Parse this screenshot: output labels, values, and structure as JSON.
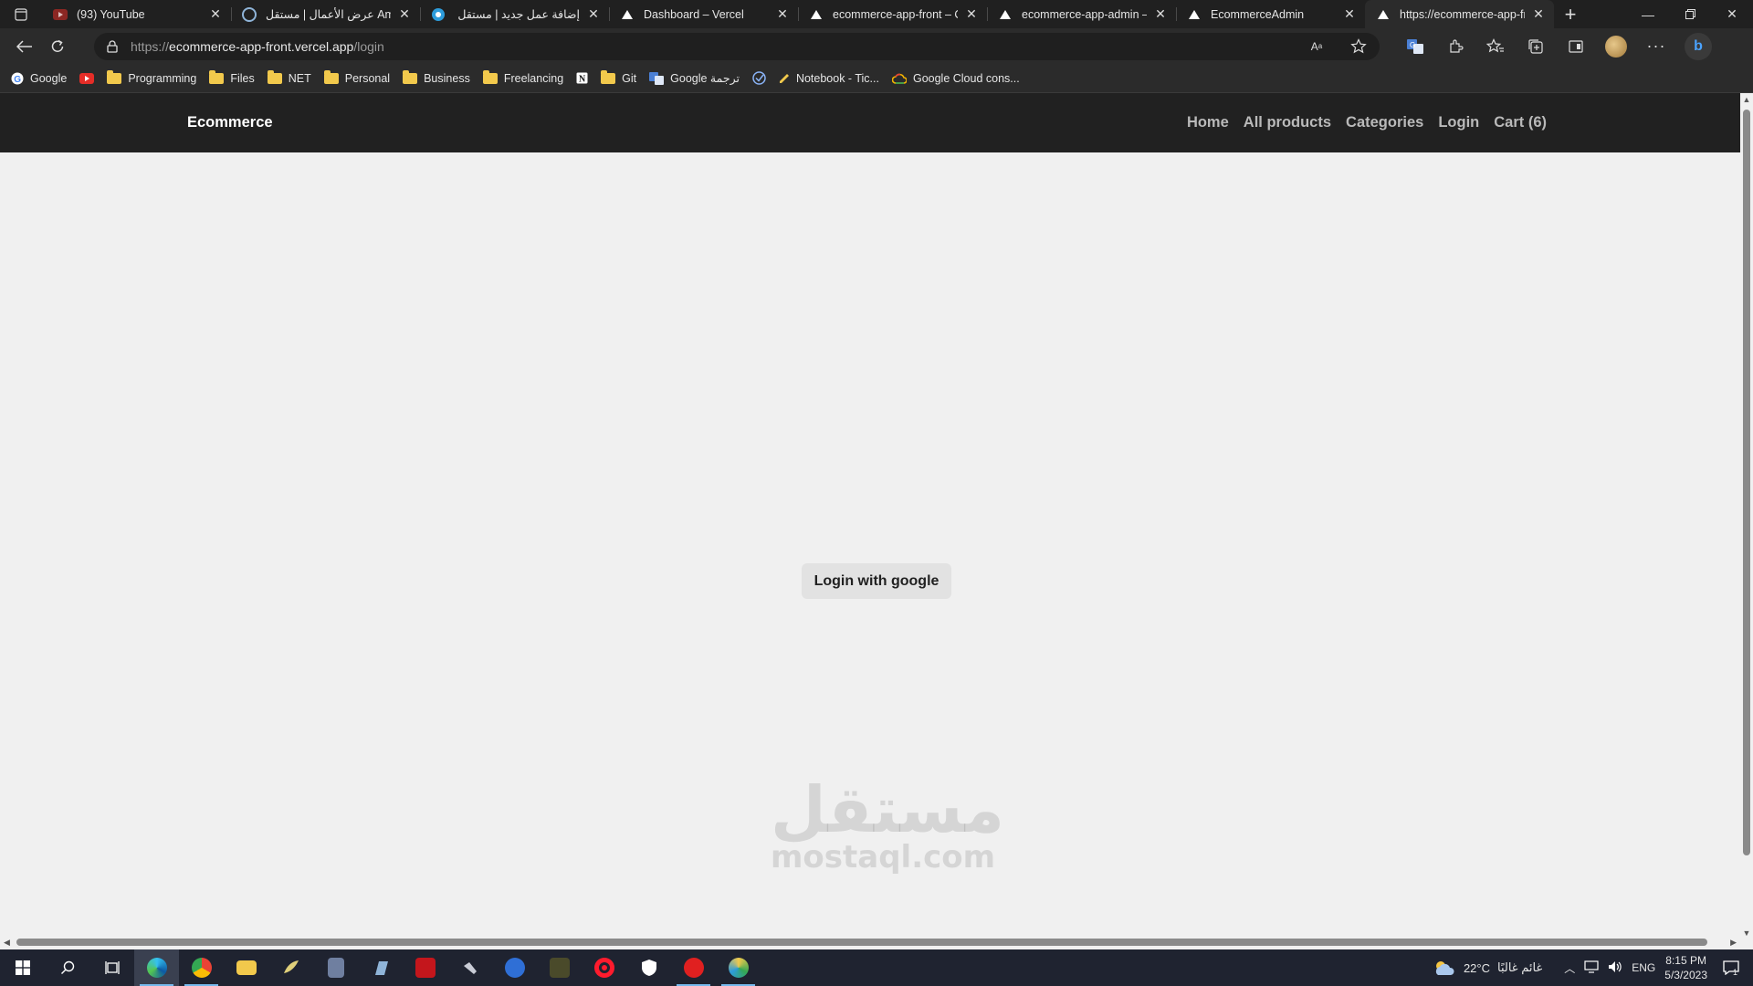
{
  "browser": {
    "tabs": [
      {
        "title": "(93) YouTube",
        "icon": "youtube-icon",
        "active": false
      },
      {
        "title": "عرض الأعمال | مستقل Amer",
        "icon": "mostaql-icon",
        "active": false
      },
      {
        "title": "إضافة عمل جديد | مستقل",
        "icon": "mostaql-icon",
        "active": false
      },
      {
        "title": "Dashboard – Vercel",
        "icon": "vercel-icon",
        "active": false
      },
      {
        "title": "ecommerce-app-front – O",
        "icon": "vercel-icon",
        "active": false
      },
      {
        "title": "ecommerce-app-admin – (",
        "icon": "vercel-icon",
        "active": false
      },
      {
        "title": "EcommerceAdmin",
        "icon": "vercel-icon",
        "active": false
      },
      {
        "title": "https://ecommerce-app-fr",
        "icon": "vercel-icon",
        "active": true
      }
    ],
    "address": {
      "scheme": "https://",
      "host": "ecommerce-app-front.vercel.app",
      "path": "/login"
    },
    "bookmarks": [
      {
        "label": "Google",
        "icon": "google-icon"
      },
      {
        "label": "",
        "icon": "youtube-icon"
      },
      {
        "label": "Programming",
        "icon": "folder-icon"
      },
      {
        "label": "Files",
        "icon": "folder-icon"
      },
      {
        "label": "NET",
        "icon": "folder-icon"
      },
      {
        "label": "Personal",
        "icon": "folder-icon"
      },
      {
        "label": "Business",
        "icon": "folder-icon"
      },
      {
        "label": "Freelancing",
        "icon": "folder-icon"
      },
      {
        "label": "",
        "icon": "notion-icon"
      },
      {
        "label": "Git",
        "icon": "folder-icon"
      },
      {
        "label": "Google ترجمة",
        "icon": "translate-icon"
      },
      {
        "label": "",
        "icon": "ticktick-icon"
      },
      {
        "label": "Notebook - Tic...",
        "icon": "pen-icon"
      },
      {
        "label": "Google Cloud cons...",
        "icon": "google-cloud-icon"
      }
    ]
  },
  "site": {
    "brand": "Ecommerce",
    "nav": {
      "home": "Home",
      "all_products": "All products",
      "categories": "Categories",
      "login": "Login",
      "cart": "Cart (6)"
    },
    "login_button": "Login with google",
    "watermark_ar": "مستقل",
    "watermark_en": "mostaql.com"
  },
  "taskbar": {
    "weather_temp": "22°C",
    "weather_desc": "غائم غالبًا",
    "language": "ENG",
    "time": "8:15 PM",
    "date": "5/3/2023",
    "notification_count": "1"
  },
  "colors": {
    "navbar_bg": "#212121",
    "page_bg": "#f0f0f0",
    "button_bg": "#e2e2e2"
  }
}
